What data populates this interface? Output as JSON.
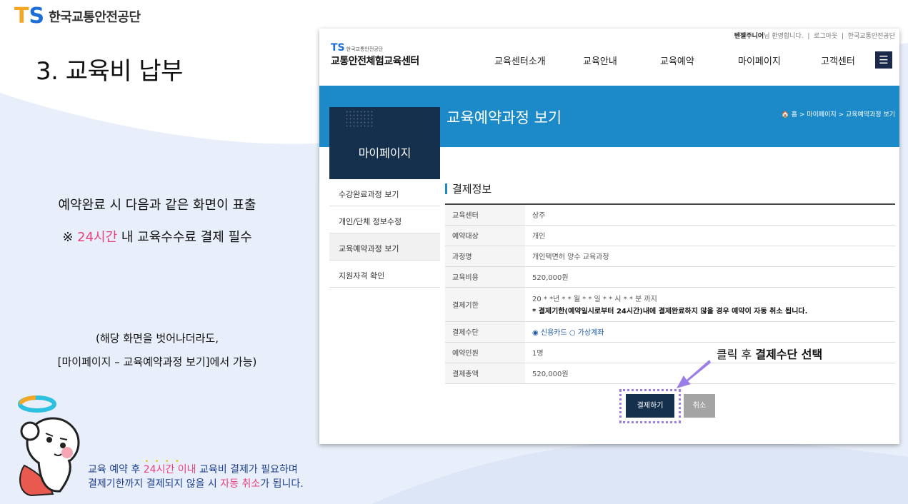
{
  "brand": {
    "mark_t": "T",
    "mark_s": "S",
    "name": "한국교통안전공단"
  },
  "slide": {
    "title": "3. 교육비 납부",
    "desc_line1": "예약완료 시 다음과 같은 화면이 표출",
    "desc_line2_prefix": "※ ",
    "desc_line2_highlight": "24시간",
    "desc_line2_suffix": " 내 교육수수료 결제 필수",
    "paren_line1": "(해당 화면을 벗어나더라도,",
    "paren_line2": "[마이페이지 – 교육예약과정 보기]에서 가능)",
    "footnote_a": "교육 예약 후 ",
    "footnote_b": "24시간 이내",
    "footnote_c": " 교육비 결제가 필요하며",
    "footnote_d": "결제기한까지 결제되지 않을 시 ",
    "footnote_e": "자동 취소",
    "footnote_f": "가 됩니다.",
    "footnote_dots": "• • • •",
    "callout_prefix": "클릭 후 ",
    "callout_bold": "결제수단 선택"
  },
  "site": {
    "user_name": "텐젤주니어",
    "welcome": "님 환영합니다.",
    "logout": "로그아웃",
    "org_link": "한국교통안전공단",
    "logo_ts": "TS",
    "logo_org": "한국교통안전공단",
    "logo_center": "교통안전체험교육센터",
    "gnb": [
      "교육센터소개",
      "교육안내",
      "교육예약",
      "마이페이지",
      "고객센터"
    ],
    "menu_icon": "☰",
    "page_title": "교육예약과정 보기",
    "breadcrumb": "🏠 홈 > 마이페이지 > 교육예약과정 보기",
    "side_title": "마이페이지",
    "side_menu": [
      "수강완료과정 보기",
      "개인/단체 정보수정",
      "교육예약과정 보기",
      "지원자격 확인"
    ],
    "section_title": "결제정보",
    "rows": [
      {
        "label": "교육센터",
        "value": "상주"
      },
      {
        "label": "예약대상",
        "value": "개인"
      },
      {
        "label": "과정명",
        "value": "개인택면허 양수 교육과정"
      },
      {
        "label": "교육비용",
        "value": "520,000원"
      },
      {
        "label": "결제기한",
        "value": "20 * *년 * * 월 * * 일 * * 시 * * 분 까지",
        "warn": "* 결제기한(예약일시로부터 24시간)내에 결제완료하지 않을 경우 예약이 자동 취소 됩니다."
      },
      {
        "label": "결제수단",
        "value": "◉ 신용카드 ○ 가상계좌"
      },
      {
        "label": "예약인원",
        "value": "1명"
      },
      {
        "label": "결제총액",
        "value": "520,000원"
      }
    ],
    "pay_button": "결제하기",
    "cancel_button": "취소"
  },
  "colors": {
    "accent": "#1c8ac9",
    "navy": "#14304d",
    "highlight": "#e8417e",
    "callout_border": "#9b7ee8"
  }
}
